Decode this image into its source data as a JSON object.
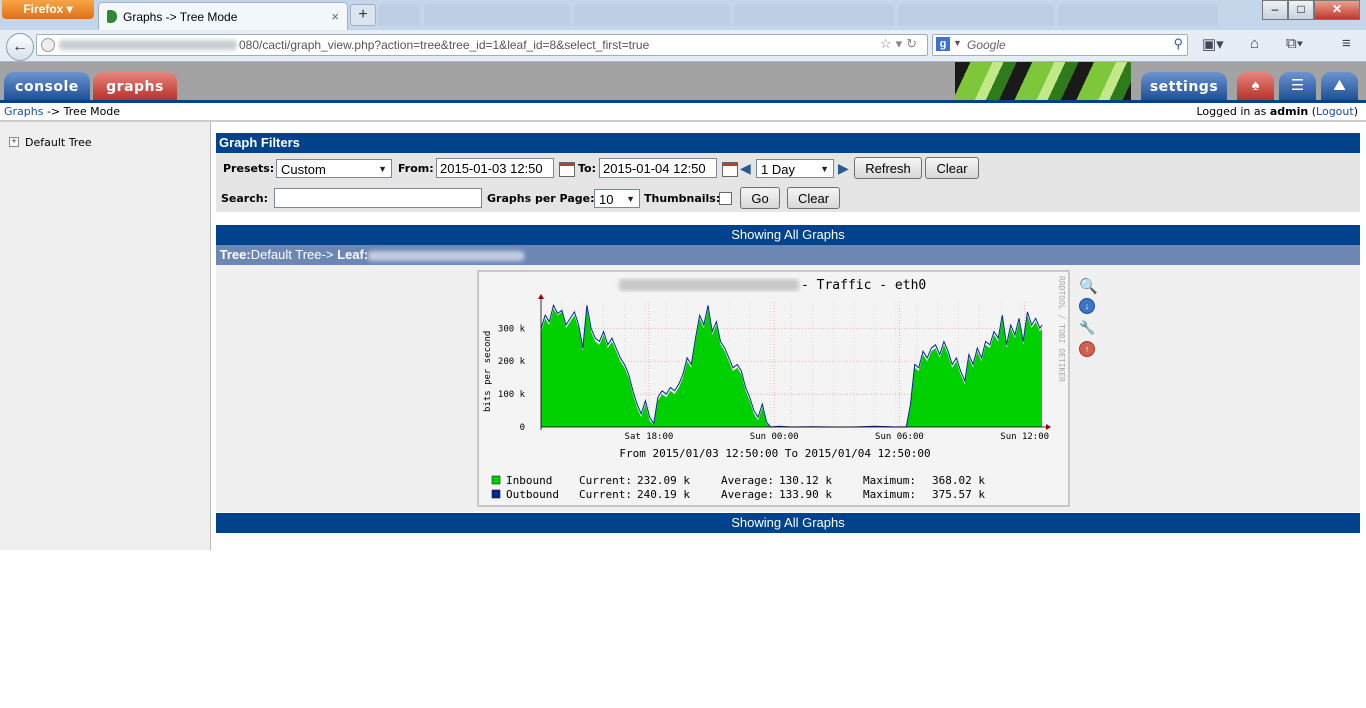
{
  "browser": {
    "firefox_button": "Firefox",
    "active_tab_title": "Graphs -> Tree Mode",
    "new_tab_label": "+",
    "url_visible": "080/cacti/graph_view.php?action=tree&tree_id=1&leaf_id=8&select_first=true",
    "search_engine": "Google",
    "search_placeholder": "Google"
  },
  "cacti": {
    "tabs": {
      "console": "console",
      "graphs": "graphs",
      "settings": "settings"
    },
    "breadcrumb_link": "Graphs",
    "breadcrumb_rest": "-> Tree Mode",
    "login_prefix": "Logged in as",
    "login_user": "admin",
    "logout_label": "Logout"
  },
  "tree": {
    "root_label": "Default Tree",
    "expander": "+"
  },
  "filters": {
    "title": "Graph Filters",
    "presets_label": "Presets:",
    "presets_value": "Custom",
    "from_label": "From:",
    "from_value": "2015-01-03 12:50",
    "to_label": "To:",
    "to_value": "2015-01-04 12:50",
    "timespan_value": "1 Day",
    "refresh_label": "Refresh",
    "clear_label": "Clear",
    "search_label": "Search:",
    "search_value": "",
    "per_page_label": "Graphs per Page:",
    "per_page_value": "10",
    "thumbnails_label": "Thumbnails:",
    "thumbnails_checked": false,
    "go_label": "Go",
    "clear2_label": "Clear"
  },
  "listing": {
    "showing_all": "Showing All Graphs",
    "tree_label": "Tree:",
    "tree_path": "Default Tree->",
    "leaf_label": "Leaf:"
  },
  "graph": {
    "title_suffix": " - Traffic - eth0",
    "ylabel": "bits per second",
    "watermark": "RRDTOOL / TOBI OETIKER",
    "range_text": "From 2015/01/03 12:50:00 To 2015/01/04 12:50:00",
    "legend": [
      {
        "name": "Inbound",
        "color": "#00cf00",
        "current": "Current:",
        "current_val": "232.09 k",
        "average": "Average:",
        "average_val": "130.12 k",
        "maximum": "Maximum:",
        "maximum_val": "368.02 k"
      },
      {
        "name": "Outbound",
        "color": "#002a97",
        "current": "Current:",
        "current_val": "240.19 k",
        "average": "Average:",
        "average_val": "133.90 k",
        "maximum": "Maximum:",
        "maximum_val": "375.57 k"
      }
    ]
  },
  "chart_data": {
    "type": "area",
    "title": " - Traffic - eth0",
    "ylabel": "bits per second",
    "xlabel": "",
    "x_ticks": [
      "Sat 18:00",
      "Sun 00:00",
      "Sun 06:00",
      "Sun 12:00"
    ],
    "y_ticks": [
      "0",
      "100 k",
      "200 k",
      "300 k"
    ],
    "ylim": [
      0,
      380
    ],
    "x_range_hours": [
      0,
      24
    ],
    "series": [
      {
        "name": "Inbound",
        "color": "#00cf00",
        "x": [
          0,
          0.2,
          0.4,
          0.6,
          0.8,
          1.0,
          1.2,
          1.4,
          1.6,
          1.8,
          2.0,
          2.2,
          2.4,
          2.6,
          2.8,
          3.0,
          3.2,
          3.4,
          3.6,
          3.8,
          4.0,
          4.2,
          4.4,
          4.6,
          4.8,
          5.0,
          5.2,
          5.4,
          5.6,
          5.8,
          6.0,
          6.2,
          6.4,
          6.6,
          6.8,
          7.0,
          7.2,
          7.4,
          7.6,
          7.8,
          8.0,
          8.2,
          8.4,
          8.6,
          8.8,
          9.0,
          9.2,
          9.4,
          9.6,
          9.8,
          10.0,
          10.2,
          10.4,
          10.6,
          10.8,
          11.0,
          11.4,
          12.0,
          13.0,
          14.0,
          15.0,
          16.0,
          17.0,
          17.5,
          17.7,
          17.9,
          18.1,
          18.3,
          18.5,
          18.7,
          18.9,
          19.1,
          19.3,
          19.5,
          19.7,
          19.9,
          20.1,
          20.3,
          20.5,
          20.7,
          20.9,
          21.1,
          21.3,
          21.5,
          21.7,
          21.9,
          22.1,
          22.3,
          22.5,
          22.7,
          22.9,
          23.1,
          23.3,
          23.5,
          23.7,
          23.9,
          24.0
        ],
        "values": [
          290,
          330,
          310,
          360,
          340,
          350,
          300,
          320,
          340,
          300,
          230,
          360,
          290,
          260,
          250,
          280,
          240,
          260,
          230,
          200,
          180,
          150,
          100,
          60,
          30,
          70,
          20,
          5,
          80,
          100,
          90,
          110,
          100,
          120,
          150,
          200,
          180,
          260,
          330,
          300,
          360,
          280,
          310,
          250,
          230,
          200,
          170,
          180,
          160,
          110,
          80,
          40,
          20,
          60,
          10,
          0,
          0,
          0,
          0,
          0,
          0,
          0,
          0,
          0,
          60,
          180,
          170,
          220,
          200,
          230,
          240,
          210,
          250,
          220,
          180,
          200,
          160,
          130,
          210,
          180,
          230,
          200,
          250,
          240,
          280,
          260,
          330,
          240,
          300,
          270,
          320,
          250,
          340,
          300,
          320,
          290,
          300
        ]
      },
      {
        "name": "Outbound",
        "color": "#002a97",
        "x": [
          0,
          0.2,
          0.4,
          0.6,
          0.8,
          1.0,
          1.2,
          1.4,
          1.6,
          1.8,
          2.0,
          2.2,
          2.4,
          2.6,
          2.8,
          3.0,
          3.2,
          3.4,
          3.6,
          3.8,
          4.0,
          4.2,
          4.4,
          4.6,
          4.8,
          5.0,
          5.2,
          5.4,
          5.6,
          5.8,
          6.0,
          6.2,
          6.4,
          6.6,
          6.8,
          7.0,
          7.2,
          7.4,
          7.6,
          7.8,
          8.0,
          8.2,
          8.4,
          8.6,
          8.8,
          9.0,
          9.2,
          9.4,
          9.6,
          9.8,
          10.0,
          10.2,
          10.4,
          10.6,
          10.8,
          11.0,
          11.4,
          12.0,
          13.0,
          14.0,
          15.0,
          16.0,
          17.0,
          17.5,
          17.7,
          17.9,
          18.1,
          18.3,
          18.5,
          18.7,
          18.9,
          19.1,
          19.3,
          19.5,
          19.7,
          19.9,
          20.1,
          20.3,
          20.5,
          20.7,
          20.9,
          21.1,
          21.3,
          21.5,
          21.7,
          21.9,
          22.1,
          22.3,
          22.5,
          22.7,
          22.9,
          23.1,
          23.3,
          23.5,
          23.7,
          23.9,
          24.0
        ],
        "values": [
          300,
          340,
          320,
          370,
          345,
          355,
          310,
          330,
          350,
          310,
          240,
          370,
          300,
          270,
          260,
          290,
          250,
          270,
          240,
          210,
          190,
          160,
          110,
          70,
          40,
          80,
          30,
          10,
          90,
          110,
          100,
          120,
          110,
          130,
          160,
          210,
          190,
          270,
          340,
          310,
          370,
          290,
          320,
          260,
          240,
          210,
          180,
          190,
          170,
          120,
          90,
          50,
          30,
          70,
          15,
          0,
          2,
          0,
          1,
          0,
          0,
          2,
          0,
          1,
          70,
          190,
          180,
          230,
          210,
          240,
          250,
          220,
          260,
          230,
          190,
          210,
          170,
          140,
          220,
          190,
          240,
          210,
          260,
          250,
          290,
          270,
          340,
          250,
          310,
          280,
          330,
          260,
          350,
          310,
          330,
          300,
          310
        ]
      }
    ]
  }
}
